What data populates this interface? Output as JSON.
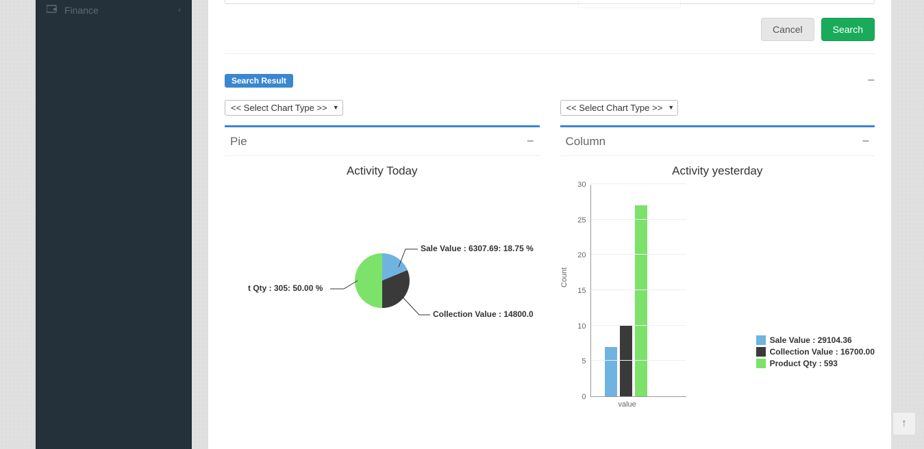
{
  "sidebar": {
    "items": [
      {
        "icon": "wallet-icon",
        "label": "Finance"
      }
    ]
  },
  "actions": {
    "cancel": "Cancel",
    "search": "Search"
  },
  "section": {
    "badge": "Search Result"
  },
  "selects": {
    "left": "<< Select Chart Type >>",
    "right": "<< Select Chart Type >>"
  },
  "panels": {
    "pie": {
      "title": "Pie"
    },
    "column": {
      "title": "Column"
    }
  },
  "colors": {
    "sale": "#6fb3e0",
    "collection": "#3a3a3a",
    "product": "#7ce26a"
  },
  "chart_data": [
    {
      "type": "pie",
      "title": "Activity Today",
      "series": [
        {
          "name": "Sale Value",
          "value": 6307.69,
          "percent": 18.75,
          "label": "Sale Value : 6307.69: 18.75 %",
          "color_key": "sale"
        },
        {
          "name": "Collection Value",
          "value": 14800.0,
          "percent": 31.25,
          "label": "Collection Value : 14800.0",
          "color_key": "collection"
        },
        {
          "name": "Product Qty",
          "value": 305,
          "percent": 50.0,
          "label": "t Qty : 305: 50.00 %",
          "color_key": "product"
        }
      ]
    },
    {
      "type": "bar",
      "title": "Activity yesterday",
      "xlabel": "value",
      "ylabel": "Count",
      "ylim": [
        0,
        30
      ],
      "yticks": [
        0,
        5,
        10,
        15,
        20,
        25,
        30
      ],
      "series": [
        {
          "name": "Sale Value",
          "legend": "Sale Value : 29104.36",
          "value": 7,
          "color_key": "sale"
        },
        {
          "name": "Collection Value",
          "legend": "Collection Value : 16700.00",
          "value": 10,
          "color_key": "collection"
        },
        {
          "name": "Product Qty",
          "legend": "Product Qty : 593",
          "value": 27,
          "color_key": "product"
        }
      ]
    }
  ]
}
